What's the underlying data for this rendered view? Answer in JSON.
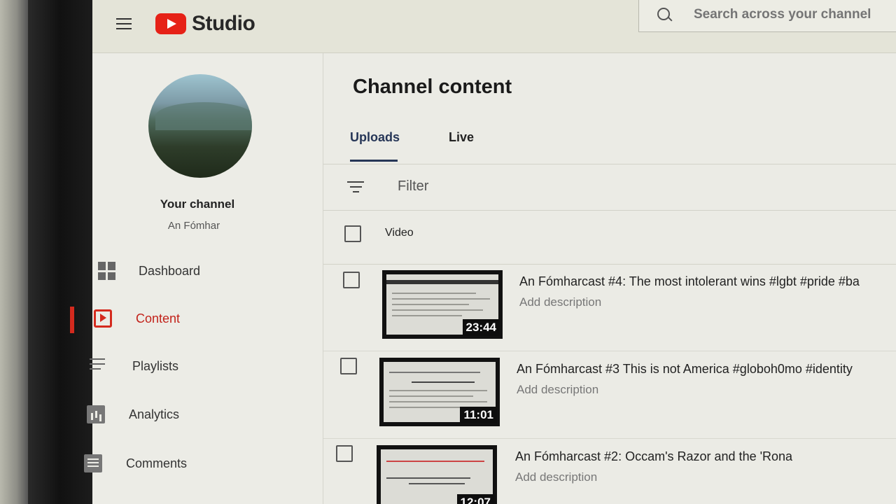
{
  "topbar": {
    "menu_icon": "hamburger-menu-icon",
    "logo_text": "Studio",
    "search_placeholder": "Search across your channel"
  },
  "sidebar": {
    "channel_label": "Your channel",
    "channel_name": "An Fómhar",
    "items": [
      {
        "label": "Dashboard",
        "icon": "dashboard-icon",
        "active": false
      },
      {
        "label": "Content",
        "icon": "content-icon",
        "active": true
      },
      {
        "label": "Playlists",
        "icon": "playlists-icon",
        "active": false
      },
      {
        "label": "Analytics",
        "icon": "analytics-icon",
        "active": false
      },
      {
        "label": "Comments",
        "icon": "comments-icon",
        "active": false
      }
    ]
  },
  "main": {
    "title": "Channel content",
    "tabs": [
      {
        "label": "Uploads",
        "active": true
      },
      {
        "label": "Live",
        "active": false
      }
    ],
    "filter_label": "Filter",
    "column_video": "Video",
    "videos": [
      {
        "title": "An Fómharcast #4: The most intolerant wins #lgbt #pride #ba",
        "description": "Add description",
        "duration": "23:44"
      },
      {
        "title": "An Fómharcast #3 This is not America #globoh0mo #identity",
        "description": "Add description",
        "duration": "11:01"
      },
      {
        "title": "An Fómharcast #2: Occam's Razor and the 'Rona",
        "description": "Add description",
        "duration": "12:07"
      }
    ]
  },
  "colors": {
    "accent_red": "#d42a1e",
    "tab_active": "#263657"
  }
}
